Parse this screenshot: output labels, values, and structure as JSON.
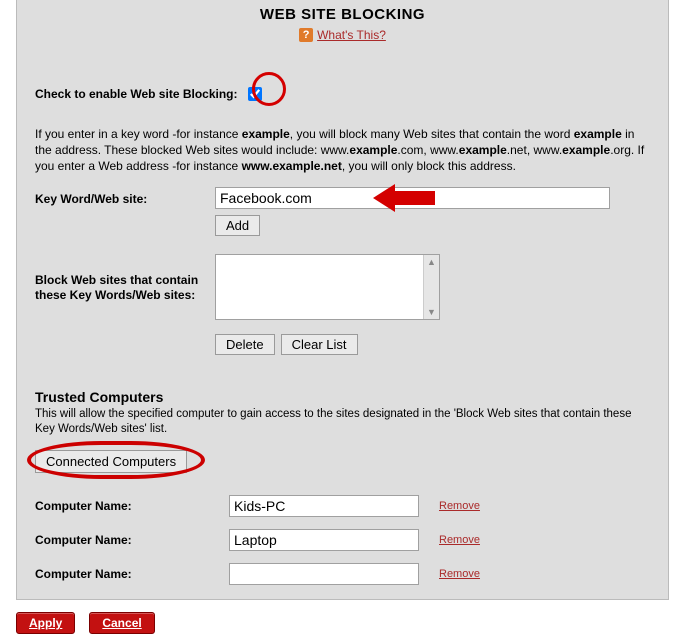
{
  "header": {
    "title": "WEB SITE BLOCKING",
    "help_label": "What's This?"
  },
  "enable": {
    "label": "Check to enable Web site Blocking:",
    "checked": true
  },
  "description": {
    "p1a": "If you enter in a key word -for instance ",
    "b1": "example",
    "p1b": ", you will block many Web sites that contain the word ",
    "b2": "example",
    "p1c": " in the address. These blocked Web sites would include: www.",
    "b3": "example",
    "p1d": ".com, www.",
    "b4": "example",
    "p1e": ".net, www.",
    "b5": "example",
    "p1f": ".org. If you enter a Web address -for instance ",
    "b6": "www.example.net",
    "p1g": ", you will only block this address."
  },
  "keyword": {
    "label": "Key Word/Web site:",
    "value": "Facebook.com",
    "add_label": "Add"
  },
  "blocklist": {
    "label": "Block Web sites that contain these Key Words/Web sites:",
    "delete_label": "Delete",
    "clear_label": "Clear List"
  },
  "trusted": {
    "heading": "Trusted Computers",
    "desc": "This will allow the specified computer to gain access to the sites designated in the 'Block Web sites that contain these Key Words/Web sites' list.",
    "connected_label": "Connected Computers"
  },
  "computers": [
    {
      "label": "Computer Name:",
      "value": "Kids-PC",
      "remove": "Remove"
    },
    {
      "label": "Computer Name:",
      "value": "Laptop",
      "remove": "Remove"
    },
    {
      "label": "Computer Name:",
      "value": "",
      "remove": "Remove"
    }
  ],
  "footer": {
    "apply": "Apply",
    "cancel": "Cancel"
  },
  "annotation_color": "#d40000"
}
